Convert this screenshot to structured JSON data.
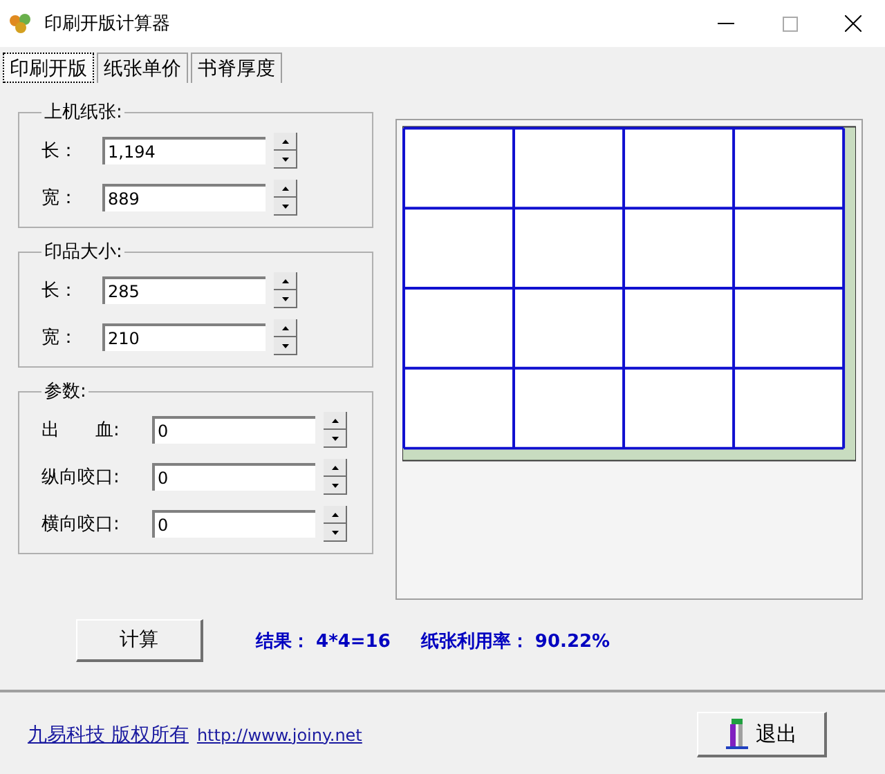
{
  "window": {
    "title": "印刷开版计算器"
  },
  "tabs": [
    {
      "label": "印刷开版",
      "selected": true
    },
    {
      "label": "纸张单价",
      "selected": false
    },
    {
      "label": "书脊厚度",
      "selected": false
    }
  ],
  "groups": [
    {
      "title": "上机纸张:",
      "fields": [
        {
          "label": "长：",
          "value": "1,194"
        },
        {
          "label": "宽：",
          "value": "889"
        }
      ]
    },
    {
      "title": "印品大小:",
      "fields": [
        {
          "label": "长：",
          "value": "285"
        },
        {
          "label": "宽：",
          "value": "210"
        }
      ]
    },
    {
      "title": "参数:",
      "fields": [
        {
          "label": "出　　血:",
          "value": "0"
        },
        {
          "label": "纵向咬口:",
          "value": "0"
        },
        {
          "label": "横向咬口:",
          "value": "0"
        }
      ]
    }
  ],
  "calculate_button": "计算",
  "result": "结果： 4*4=16",
  "utilization": "纸张利用率： 90.22%",
  "footer_link": "九易科技 版权所有",
  "footer_url": "http://www.joiny.net",
  "exit_button": "退出"
}
